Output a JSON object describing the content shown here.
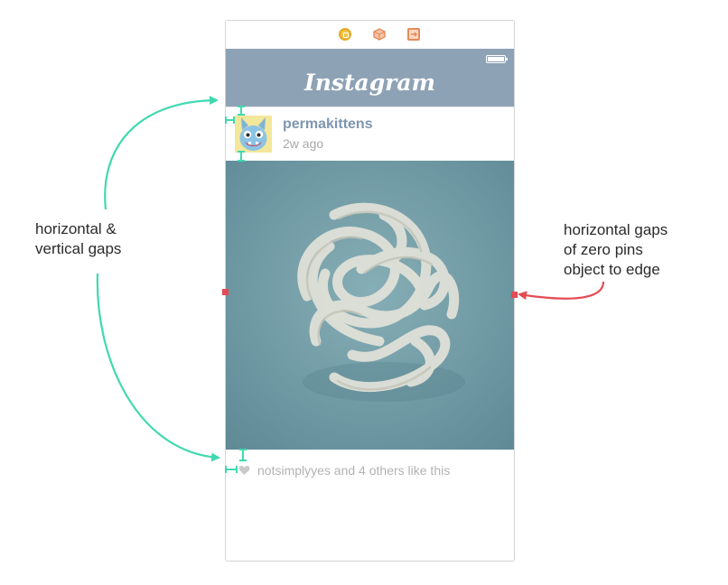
{
  "annotations": {
    "left": [
      "horizontal &",
      "vertical gaps"
    ],
    "right": [
      "horizontal gaps",
      "of zero pins",
      "object to edge"
    ]
  },
  "scene_dock": {
    "icons": [
      "view-controller-icon",
      "first-responder-icon",
      "exit-icon"
    ]
  },
  "nav": {
    "title": "Instagram",
    "status_icon": "battery-icon"
  },
  "post": {
    "username": "permakittens",
    "time": "2w ago",
    "likes": "notsimplyyes and 4 others like this",
    "like_icon": "heart-icon"
  },
  "colors": {
    "nav_bar": "#8ea2b5",
    "username": "#7e96b1",
    "constraint": "#40d9b0",
    "edge_pin": "#e54b55",
    "photo_background": "#6f9aa4"
  }
}
